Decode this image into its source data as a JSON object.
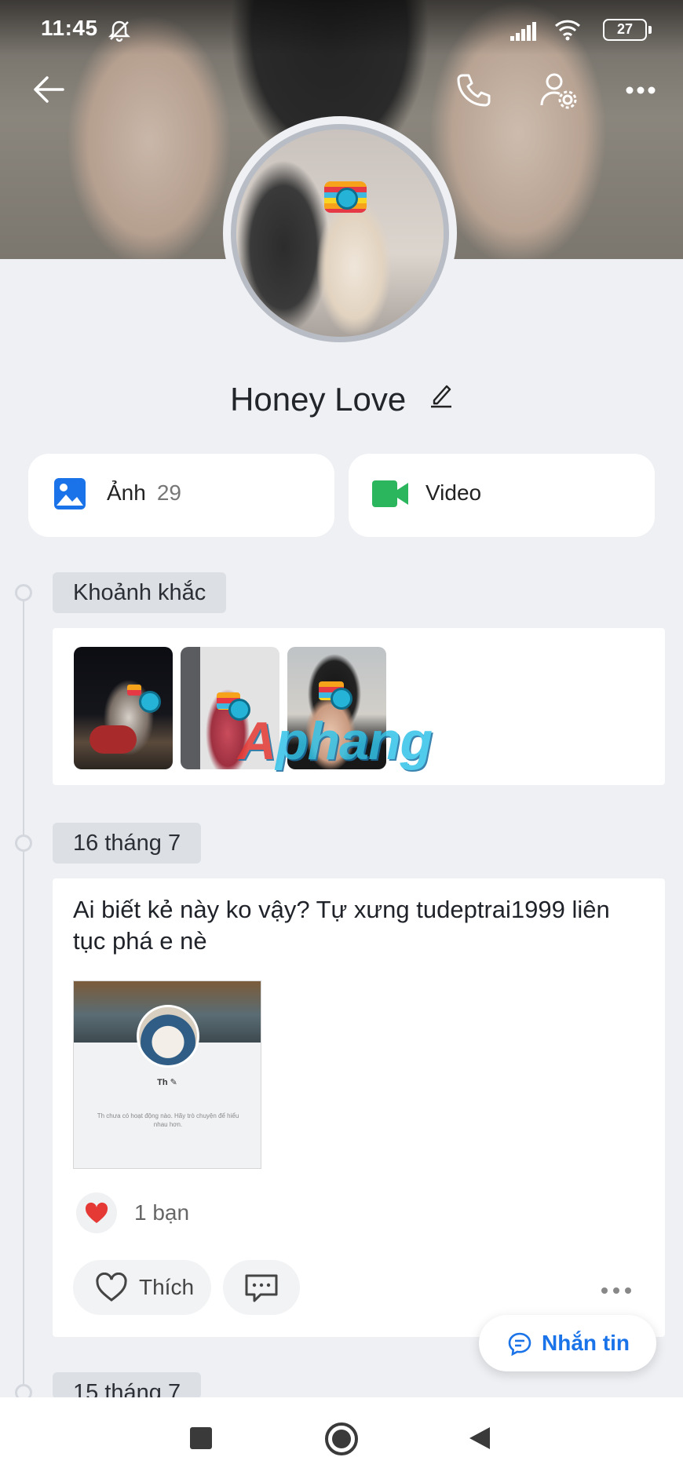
{
  "status_bar": {
    "time": "11:45",
    "battery": "27"
  },
  "profile": {
    "name": "Honey Love"
  },
  "media": {
    "photos_label": "Ảnh",
    "photos_count": "29",
    "video_label": "Video"
  },
  "moments": {
    "section_label": "Khoảnh khắc"
  },
  "watermark": {
    "prefix": "A",
    "text": "phang"
  },
  "post": {
    "date_label": "16 tháng 7",
    "text": "Ai biết kẻ này ko vậy? Tự xưng tudeptrai1999 liên tục phá e nè",
    "screenshot_name": "Th",
    "screenshot_note": "Th chưa có hoạt động nào. Hãy trò chuyện để hiểu nhau hơn.",
    "reaction_count": "1 bạn",
    "like_label": "Thích"
  },
  "next_section": {
    "date_label": "15 tháng 7"
  },
  "message_button": {
    "label": "Nhắn tin"
  },
  "colors": {
    "accent": "#1a73e8",
    "photo_icon": "#1a73e8",
    "video_icon": "#2bb55d",
    "heart": "#e53935"
  }
}
